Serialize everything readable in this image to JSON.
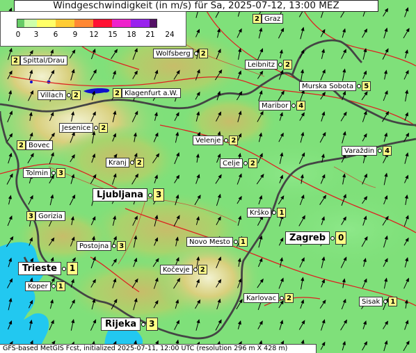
{
  "title": "Windgeschwindigkeit (in m/s) für Sa, 2025-07-12, 13:00 MEZ",
  "legend": {
    "ticks": [
      "0",
      "3",
      "6",
      "9",
      "12",
      "15",
      "18",
      "21",
      "24"
    ],
    "colors": [
      "#66cc66",
      "#ccffaa",
      "#ffff66",
      "#ffcc33",
      "#ff8833",
      "#ff1133",
      "#ee22cc",
      "#9922ee",
      "#551166"
    ]
  },
  "places": [
    {
      "name": "Graz",
      "value": "2",
      "value_first": true
    },
    {
      "name": "Spittal/Drau",
      "value": "2",
      "value_first": true
    },
    {
      "name": "Wolfsberg",
      "value": "2"
    },
    {
      "name": "Leibnitz",
      "value": "2"
    },
    {
      "name": "Villach",
      "value": "2"
    },
    {
      "name": "Klagenfurt a.W.",
      "value": "2",
      "value_first": true
    },
    {
      "name": "Murska Sobota",
      "value": "5"
    },
    {
      "name": "Maribor",
      "value": "4"
    },
    {
      "name": "Jesenice",
      "value": "2"
    },
    {
      "name": "Bovec",
      "value": "2",
      "value_first": true
    },
    {
      "name": "Velenje",
      "value": "2"
    },
    {
      "name": "Varaždin",
      "value": "4"
    },
    {
      "name": "Kranj",
      "value": "2"
    },
    {
      "name": "Celje",
      "value": "2"
    },
    {
      "name": "Tolmin",
      "value": "3"
    },
    {
      "name": "Ljubljana",
      "value": "3",
      "big": true
    },
    {
      "name": "Krško",
      "value": "1"
    },
    {
      "name": "Gorizia",
      "value": "3",
      "value_first": true
    },
    {
      "name": "Zagreb",
      "value": "0",
      "big": true
    },
    {
      "name": "Novo Mesto",
      "value": "1"
    },
    {
      "name": "Postojna",
      "value": "3"
    },
    {
      "name": "Trieste",
      "value": "1",
      "big": true
    },
    {
      "name": "Kočevje",
      "value": "2"
    },
    {
      "name": "Koper",
      "value": "1"
    },
    {
      "name": "Karlovac",
      "value": "2"
    },
    {
      "name": "Sisak",
      "value": "1"
    },
    {
      "name": "Rijeka",
      "value": "3",
      "big": true
    }
  ],
  "footer": "GFS-based MetGIS Fcst, initialized 2025-07-11, 12:00 UTC  (resolution 296 m X 428 m)",
  "wind_direction": "from south-southwest"
}
